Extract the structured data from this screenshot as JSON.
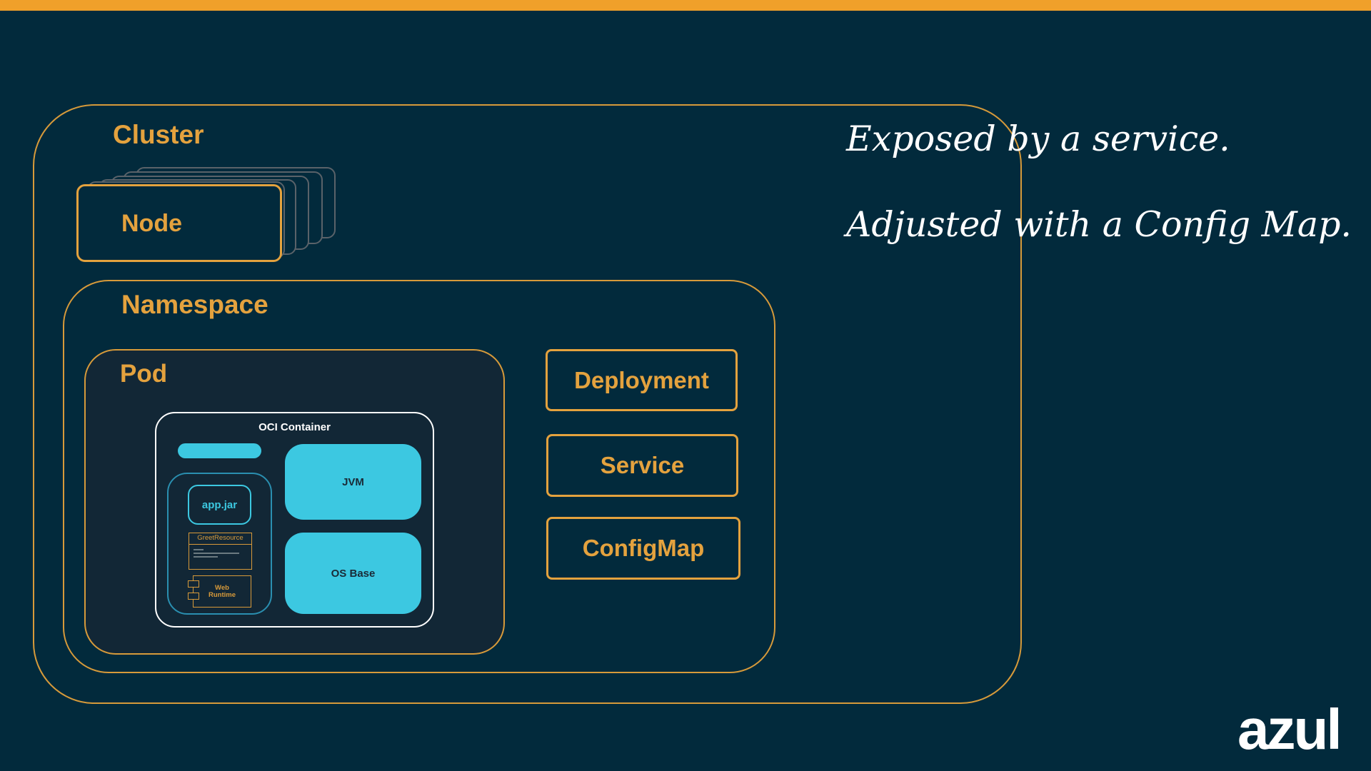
{
  "colors": {
    "background": "#022a3c",
    "accent_bar": "#f0a02a",
    "orange": "#e4a23e",
    "cyan": "#3cc8e1",
    "white": "#ffffff"
  },
  "diagram": {
    "cluster_label": "Cluster",
    "node_label": "Node",
    "namespace_label": "Namespace",
    "pod_label": "Pod",
    "container": {
      "title": "OCI Container",
      "app_jar": "app.jar",
      "greet_resource": "GreetResource",
      "web_runtime": "Web Runtime",
      "jvm": "JVM",
      "os_base": "OS Base"
    },
    "resources": {
      "deployment": "Deployment",
      "service": "Service",
      "configmap": "ConfigMap"
    }
  },
  "captions": {
    "line1": "Exposed by a service.",
    "line2": "Adjusted with a Config Map."
  },
  "logo": "azul"
}
